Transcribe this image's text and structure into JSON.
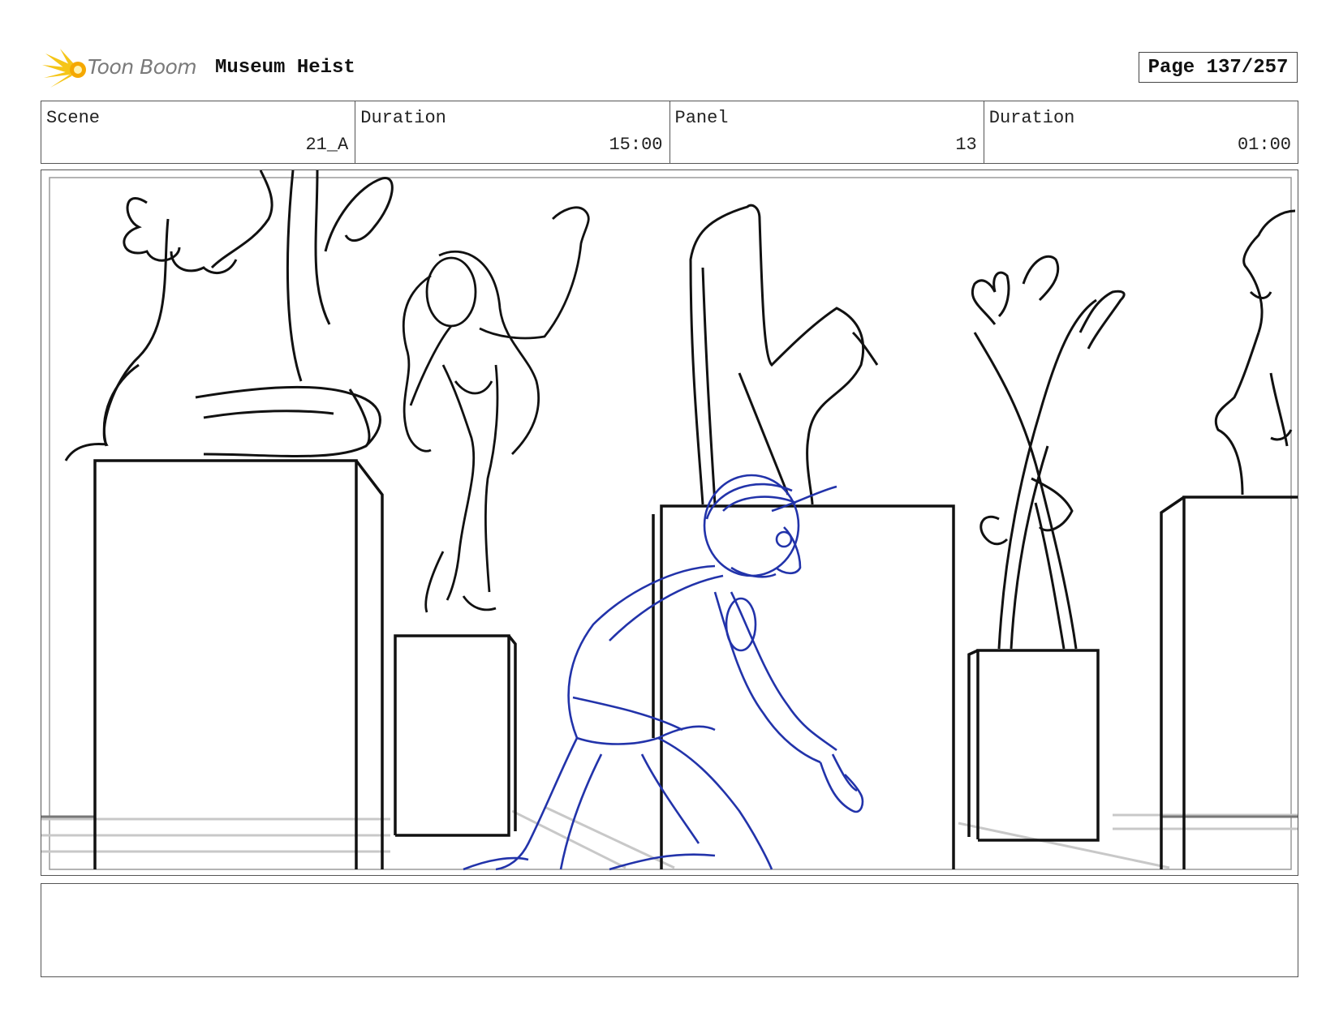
{
  "header": {
    "brand_name": "Toon Boom",
    "brand_icon": "sunburst-logo-icon",
    "project_title": "Museum Heist",
    "page_counter": "Page 137/257"
  },
  "info_table": [
    {
      "label": "Scene",
      "value": "21_A"
    },
    {
      "label": "Duration",
      "value": "15:00"
    },
    {
      "label": "Panel",
      "value": "13"
    },
    {
      "label": "Duration",
      "value": "01:00"
    }
  ],
  "panel": {
    "sketch_colors": {
      "line": "#111111",
      "character": "#2233aa",
      "floor": "#c8c8c8"
    }
  },
  "notes": {
    "text": ""
  },
  "colors": {
    "border": "#555555",
    "logo_yellow": "#f5c518",
    "brand_text": "#7a7a7a"
  }
}
